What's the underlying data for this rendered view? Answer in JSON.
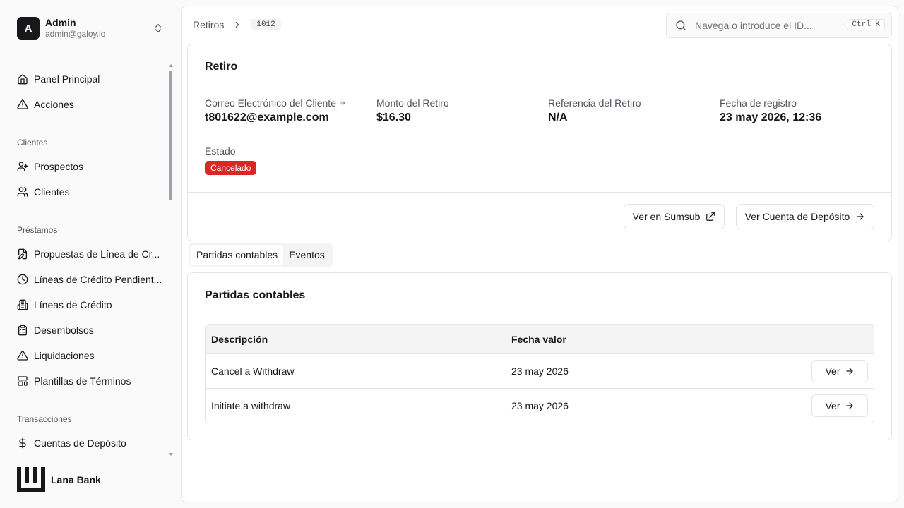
{
  "user": {
    "initial": "A",
    "name": "Admin",
    "email": "admin@galoy.io"
  },
  "nav": {
    "top": [
      {
        "label": "Panel Principal",
        "icon": "home-icon"
      },
      {
        "label": "Acciones",
        "icon": "alert-triangle-icon"
      }
    ],
    "groups": [
      {
        "label": "Clientes",
        "items": [
          {
            "label": "Prospectos",
            "icon": "user-plus-icon"
          },
          {
            "label": "Clientes",
            "icon": "users-icon"
          }
        ]
      },
      {
        "label": "Préstamos",
        "items": [
          {
            "label": "Propuestas de Línea de Cr...",
            "icon": "file-edit-icon"
          },
          {
            "label": "Líneas de Crédito Pendient...",
            "icon": "clock-icon"
          },
          {
            "label": "Líneas de Crédito",
            "icon": "building-icon"
          },
          {
            "label": "Desembolsos",
            "icon": "clipboard-list-icon"
          },
          {
            "label": "Liquidaciones",
            "icon": "alert-triangle-icon"
          },
          {
            "label": "Plantillas de Términos",
            "icon": "layout-template-icon"
          }
        ]
      },
      {
        "label": "Transacciones",
        "items": [
          {
            "label": "Cuentas de Depósito",
            "icon": "dollar-icon"
          }
        ]
      }
    ]
  },
  "brand": {
    "name": "Lana Bank"
  },
  "breadcrumb": {
    "parent": "Retiros",
    "current": "1012"
  },
  "search": {
    "placeholder": "Navega o introduce el ID...",
    "shortcut": "Ctrl K"
  },
  "withdrawal": {
    "title": "Retiro",
    "fields": {
      "email_label": "Correo Electrónico del Cliente",
      "email_value": "t801622@example.com",
      "amount_label": "Monto del Retiro",
      "amount_value": "$16.30",
      "reference_label": "Referencia del Retiro",
      "reference_value": "N/A",
      "date_label": "Fecha de registro",
      "date_value": "23 may 2026, 12:36",
      "status_label": "Estado",
      "status_value": "Cancelado"
    },
    "status_color": "#dc2626",
    "actions": {
      "sumsub": "Ver en Sumsub",
      "deposit_account": "Ver Cuenta de Depósito"
    }
  },
  "tabs": [
    {
      "label": "Partidas contables",
      "active": true
    },
    {
      "label": "Eventos",
      "active": false
    }
  ],
  "entries": {
    "title": "Partidas contables",
    "columns": [
      "Descripción",
      "Fecha valor"
    ],
    "rows": [
      {
        "description": "Cancel a Withdraw",
        "date": "23 may 2026",
        "action": "Ver"
      },
      {
        "description": "Initiate a withdraw",
        "date": "23 may 2026",
        "action": "Ver"
      }
    ]
  }
}
